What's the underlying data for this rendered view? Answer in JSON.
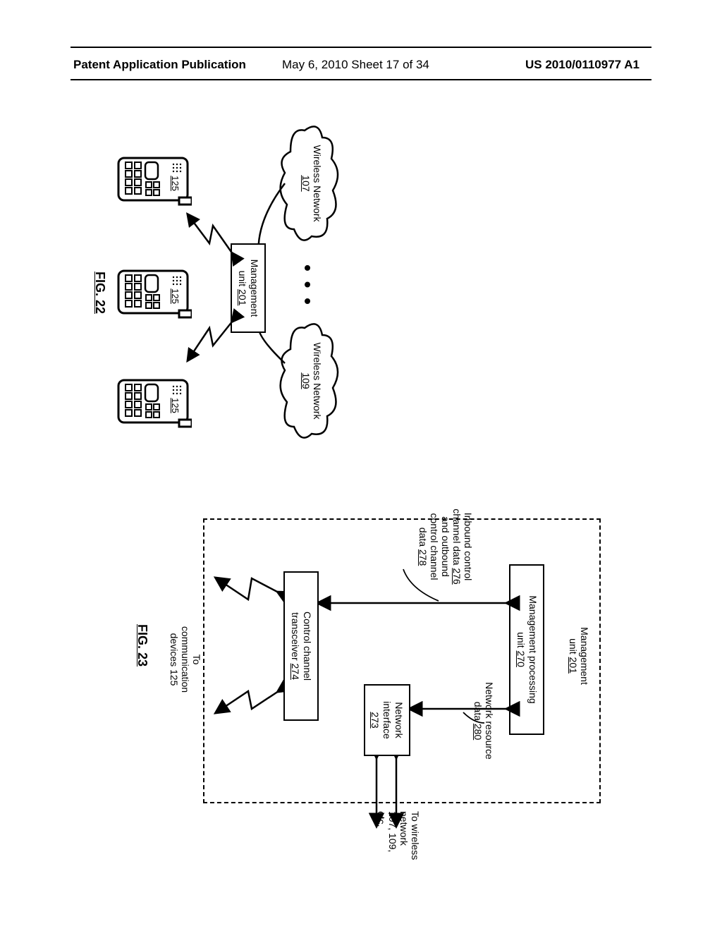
{
  "header": {
    "left": "Patent Application Publication",
    "center": "May 6, 2010  Sheet 17 of 34",
    "right": "US 2010/0110977 A1"
  },
  "fig22": {
    "cloud_a_line1": "Wireless Network",
    "cloud_a_line2": "107",
    "dots": "• • •",
    "cloud_b_line1": "Wireless Network",
    "cloud_b_line2": "109",
    "mgmt_line1": "Management",
    "mgmt_line2": "unit 201",
    "phone_label": "125",
    "caption": "FIG. 22"
  },
  "fig23": {
    "title_line1": "Management",
    "title_line2": "unit 201",
    "mpu_line1": "Management processing",
    "mpu_line2": "unit 270",
    "inbound_l1": "Inbound control",
    "inbound_l2": "channel data 276",
    "inbound_l3": "and outbound",
    "inbound_l4": "control channel",
    "inbound_l5": "data 278",
    "netres_l1": "Network resource",
    "netres_l2": "data 280",
    "niface_l1": "Network",
    "niface_l2": "interface",
    "niface_l3": "273",
    "cct_l1": "Control channel",
    "cct_l2": "transceiver 274",
    "to_dev_l1": "To",
    "to_dev_l2": "communication",
    "to_dev_l3": "devices 125",
    "to_net_l1": "To wireless",
    "to_net_l2": "network",
    "to_net_l3": "107, 109,",
    "to_net_l4": "etc.",
    "caption": "FIG. 23"
  }
}
